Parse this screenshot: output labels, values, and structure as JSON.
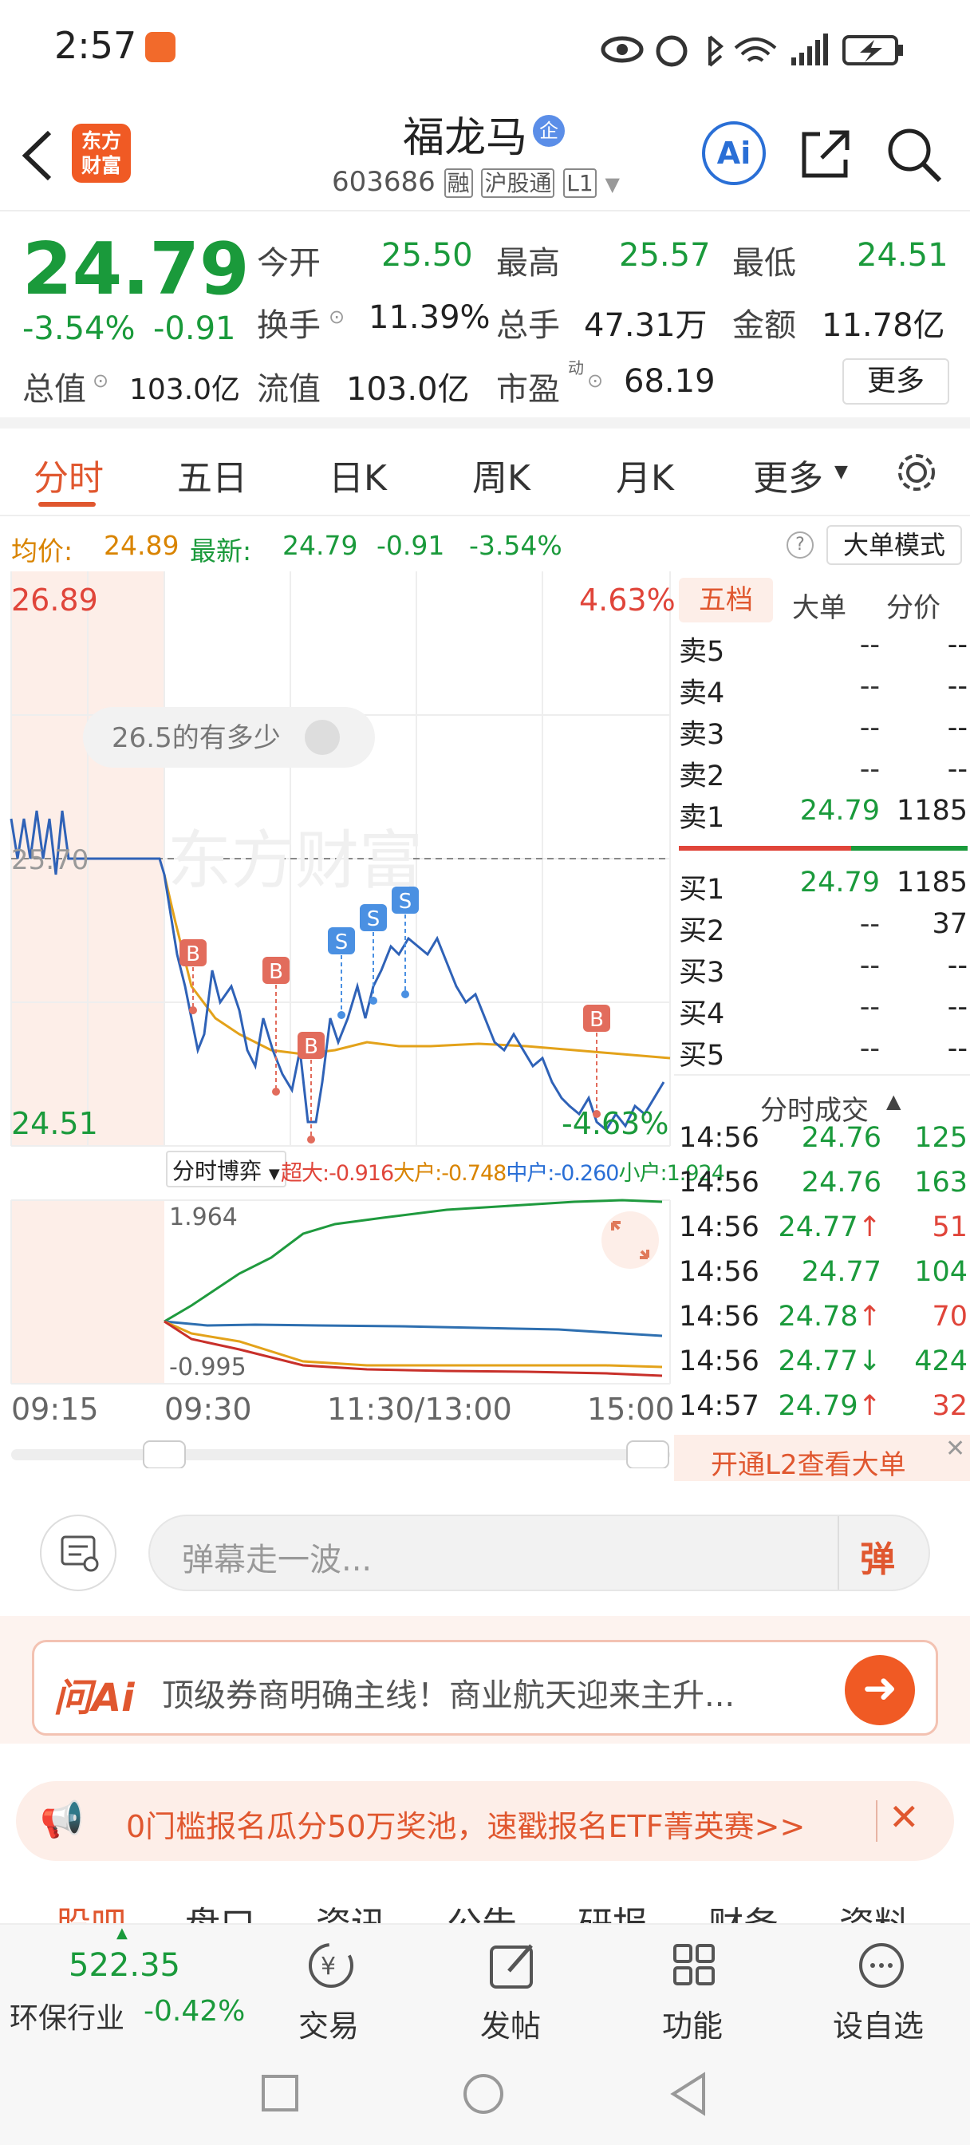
{
  "status": {
    "time": "2:57"
  },
  "header": {
    "logo_text": "东方财富",
    "title": "福龙马",
    "title_badge": "企",
    "code": "603686",
    "tags": [
      "融",
      "沪股通",
      "L1"
    ],
    "ai_label": "Ai"
  },
  "quote": {
    "price": "24.79",
    "change_pct": "-3.54%",
    "change": "-0.91",
    "open_label": "今开",
    "open": "25.50",
    "high_label": "最高",
    "high": "25.57",
    "low_label": "最低",
    "low": "24.51",
    "turnover_label": "换手",
    "turnover": "11.39%",
    "volume_label": "总手",
    "volume": "47.31万",
    "amount_label": "金额",
    "amount": "11.78亿",
    "mktcap_label": "总值",
    "mktcap": "103.0亿",
    "float_label": "流值",
    "float": "103.0亿",
    "pe_label": "市盈",
    "pe_sup": "动",
    "pe": "68.19",
    "more_button": "更多"
  },
  "tabs": {
    "items": [
      "分时",
      "五日",
      "日K",
      "周K",
      "月K",
      "更多"
    ],
    "active": "分时"
  },
  "infobar": {
    "avg_label": "均价:",
    "avg": "24.89",
    "latest_label": "最新:",
    "latest": "24.79",
    "latest_change": "-0.91",
    "latest_pct": "-3.54%",
    "big_order_mode": "大单模式"
  },
  "chart": {
    "y_top": "26.89",
    "y_bottom": "24.51",
    "y_mid": "25.70",
    "pct_top": "4.63%",
    "pct_bottom": "-4.63%",
    "watermark": "东方财富",
    "bubble": "26.5的有多少",
    "game_label": "分时博弈",
    "flows": {
      "super_label": "超大:",
      "super": "-0.916",
      "big_label": "大户:",
      "big": "-0.748",
      "mid_label": "中户:",
      "mid": "-0.260",
      "small_label": "小户:",
      "small": "1.924"
    },
    "sub_top": "1.964",
    "sub_bottom": "-0.995",
    "time_labels": [
      "09:15",
      "09:30",
      "11:30/13:00",
      "15:00"
    ],
    "markers": [
      "B",
      "B",
      "B",
      "S",
      "S",
      "S",
      "B"
    ],
    "colors": {
      "price": "#2f62b7",
      "avg": "#e3a21a",
      "buy": "#e26c5c",
      "sell": "#4a90e2"
    }
  },
  "book": {
    "tabs": [
      "五档",
      "大单",
      "分价"
    ],
    "asks": [
      {
        "label": "卖5",
        "price": "--",
        "vol": "--"
      },
      {
        "label": "卖4",
        "price": "--",
        "vol": "--"
      },
      {
        "label": "卖3",
        "price": "--",
        "vol": "--"
      },
      {
        "label": "卖2",
        "price": "--",
        "vol": "--"
      },
      {
        "label": "卖1",
        "price": "24.79",
        "vol": "1185"
      }
    ],
    "bids": [
      {
        "label": "买1",
        "price": "24.79",
        "vol": "1185"
      },
      {
        "label": "买2",
        "price": "--",
        "vol": "37"
      },
      {
        "label": "买3",
        "price": "--",
        "vol": "--"
      },
      {
        "label": "买4",
        "price": "--",
        "vol": "--"
      },
      {
        "label": "买5",
        "price": "--",
        "vol": "--"
      }
    ],
    "trades_title": "分时成交",
    "trades": [
      {
        "time": "14:56",
        "price": "24.76",
        "arrow": "",
        "vol": "125",
        "dir": "g"
      },
      {
        "time": "14:56",
        "price": "24.76",
        "arrow": "",
        "vol": "163",
        "dir": "g"
      },
      {
        "time": "14:56",
        "price": "24.77",
        "arrow": "↑",
        "vol": "51",
        "dir": "r"
      },
      {
        "time": "14:56",
        "price": "24.77",
        "arrow": "",
        "vol": "104",
        "dir": "g"
      },
      {
        "time": "14:56",
        "price": "24.78",
        "arrow": "↑",
        "vol": "70",
        "dir": "r"
      },
      {
        "time": "14:56",
        "price": "24.77",
        "arrow": "↓",
        "vol": "424",
        "dir": "g"
      },
      {
        "time": "14:57",
        "price": "24.79",
        "arrow": "↑",
        "vol": "32",
        "dir": "r"
      }
    ],
    "l2_promo": "开通L2查看大单"
  },
  "danmu": {
    "placeholder": "弹幕走一波...",
    "button": "弹"
  },
  "ai_banner": {
    "brand": "问Ai",
    "text": "顶级券商明确主线！商业航天迎来主升..."
  },
  "ad": {
    "text": "0门槛报名瓜分50万奖池，速戳报名ETF菁英赛>>"
  },
  "subtabs": [
    "股吧",
    "盘口",
    "资讯",
    "公告",
    "研报",
    "财务",
    "资料"
  ],
  "bottom": {
    "index_value": "522.35",
    "index_name": "环保行业",
    "index_change": "-0.42%",
    "items": [
      "交易",
      "发帖",
      "功能",
      "设自选"
    ]
  }
}
